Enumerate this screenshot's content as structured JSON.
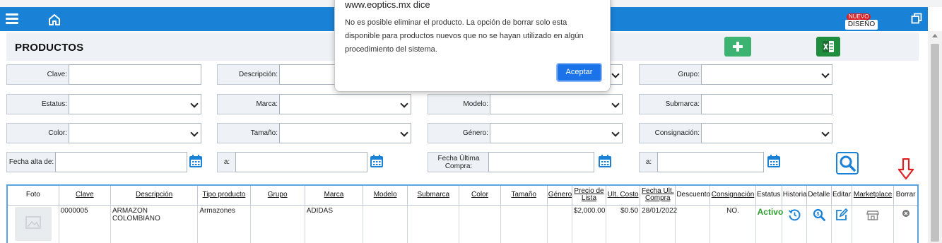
{
  "header": {
    "badge_new": "NUEVO",
    "badge_design": "DISEÑO"
  },
  "page": {
    "title": "PRODUCTOS"
  },
  "filters": {
    "clave": "Clave:",
    "descripcion": "Descripción:",
    "grupo": "Grupo:",
    "estatus": "Estatus:",
    "marca": "Marca:",
    "modelo": "Modelo:",
    "submarca": "Submarca:",
    "color": "Color:",
    "tamano": "Tamaño:",
    "genero": "Género:",
    "consignacion": "Consignación:",
    "fecha_alta": "Fecha alta de:",
    "a": "a:",
    "fecha_ultima_compra": "Fecha Última Compra:"
  },
  "table": {
    "columns": [
      "Foto",
      "Clave",
      "Descripción",
      "Tipo producto",
      "Grupo",
      "Marca",
      "Modelo",
      "Submarca",
      "Color",
      "Tamaño",
      "Género",
      "Precio de Lista",
      "Ult. Costo",
      "Fecha Ult. Compra",
      "Descuento",
      "Consignación",
      "Estatus",
      "Historia",
      "Detalle",
      "Editar",
      "Marketplace",
      "Borrar"
    ],
    "rows": [
      {
        "clave": "0000005",
        "descripcion": "ARMAZON COLOMBIANO",
        "tipo": "Armazones",
        "grupo": "",
        "marca": "ADIDAS",
        "modelo": "",
        "submarca": "",
        "color": "",
        "tamano": "",
        "genero": "",
        "precio": "$2,000.00",
        "costo": "$0.50",
        "fecha": "28/01/2022",
        "descuento": "",
        "consignacion": "NO.",
        "estatus": "Activo"
      }
    ]
  },
  "dialog": {
    "title": "www.eoptics.mx dice",
    "message": "No es posible eliminar el producto. La opción de borrar solo esta disponible para productos nuevos que no se hayan utilizado en algún procedimiento del sistema.",
    "accept": "Aceptar"
  },
  "colors": {
    "topbar": "#1a82d6",
    "accent_green": "#3cb371",
    "excel_green": "#1e8d3e",
    "status_active": "#2e9b2e",
    "alert_arrow": "#e02020"
  },
  "icons": [
    "hamburger-icon",
    "home-icon",
    "restore-window-icon",
    "plus-icon",
    "excel-icon",
    "calendar-icon",
    "search-icon",
    "history-icon",
    "detail-search-icon",
    "edit-icon",
    "marketplace-store-icon",
    "delete-circle-icon",
    "arrow-down-icon"
  ]
}
